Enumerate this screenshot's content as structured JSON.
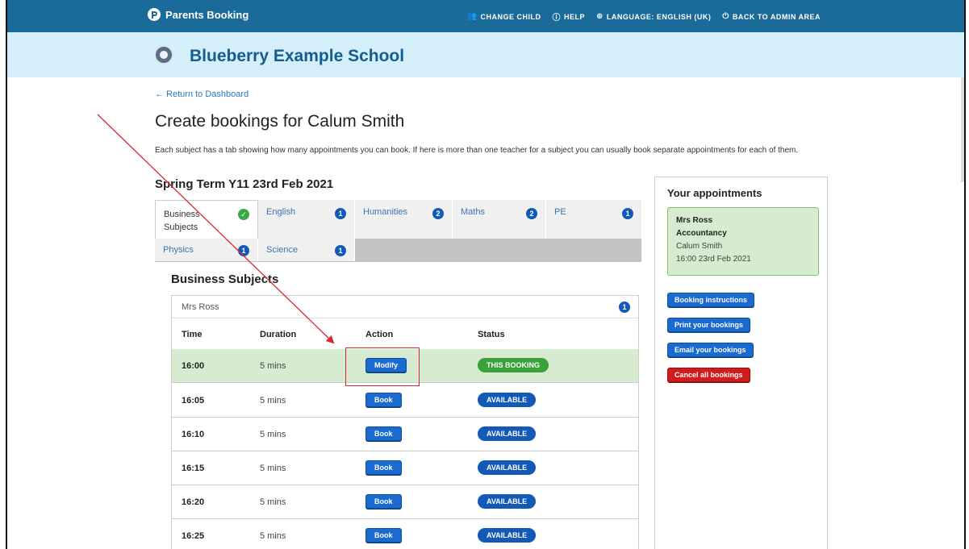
{
  "topbar": {
    "brand": "Parents Booking",
    "links": [
      {
        "icon": "users-icon",
        "glyph": "👥",
        "label": "CHANGE CHILD"
      },
      {
        "icon": "help-icon",
        "glyph": "ⓘ",
        "label": "HELP"
      },
      {
        "icon": "globe-icon",
        "glyph": "⊕",
        "label": "LANGUAGE: ENGLISH (UK)"
      },
      {
        "icon": "power-icon",
        "glyph": "⏻",
        "label": "BACK TO ADMIN AREA"
      }
    ]
  },
  "school": {
    "name": "Blueberry Example School"
  },
  "return_link": "← Return to Dashboard",
  "page_title": "Create bookings for Calum Smith",
  "intro": "Each subject has a tab showing how many appointments you can book. If here is more than one teacher for a subject you can usually book separate appointments for each of them.",
  "term_title": "Spring Term Y11 23rd Feb 2021",
  "tabs": [
    {
      "label": "Business Subjects",
      "badge": "✓",
      "active": true
    },
    {
      "label": "English",
      "badge": "1"
    },
    {
      "label": "Humanities",
      "badge": "2"
    },
    {
      "label": "Maths",
      "badge": "2"
    },
    {
      "label": "PE",
      "badge": "1"
    },
    {
      "label": "Physics",
      "badge": "1"
    },
    {
      "label": "Science",
      "badge": "1"
    }
  ],
  "section_title": "Business Subjects",
  "teacher": {
    "name": "Mrs Ross",
    "badge": "1"
  },
  "table": {
    "headers": {
      "time": "Time",
      "duration": "Duration",
      "action": "Action",
      "status": "Status"
    },
    "rows": [
      {
        "time": "16:00",
        "duration": "5 mins",
        "action": "Modify",
        "status": "THIS BOOKING"
      },
      {
        "time": "16:05",
        "duration": "5 mins",
        "action": "Book",
        "status": "AVAILABLE"
      },
      {
        "time": "16:10",
        "duration": "5 mins",
        "action": "Book",
        "status": "AVAILABLE"
      },
      {
        "time": "16:15",
        "duration": "5 mins",
        "action": "Book",
        "status": "AVAILABLE"
      },
      {
        "time": "16:20",
        "duration": "5 mins",
        "action": "Book",
        "status": "AVAILABLE"
      },
      {
        "time": "16:25",
        "duration": "5 mins",
        "action": "Book",
        "status": "AVAILABLE"
      }
    ]
  },
  "side": {
    "title": "Your appointments",
    "appointment": {
      "teacher": "Mrs Ross",
      "subject": "Accountancy",
      "child": "Calum Smith",
      "when": "16:00 23rd Feb 2021"
    },
    "buttons": {
      "instructions": "Booking instructions",
      "print": "Print your bookings",
      "email": "Email your bookings",
      "cancel": "Cancel all bookings"
    }
  },
  "colors": {
    "topbar": "#1a6a9a",
    "banner": "#d4eefa",
    "primary_button": "#1a6ad0",
    "badge": "#1259b8",
    "success": "#3aa23a",
    "danger": "#d21b1b",
    "annotation": "#d9282d"
  }
}
